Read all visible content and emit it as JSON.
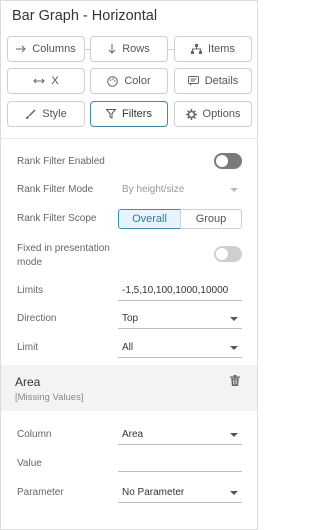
{
  "header": {
    "title": "Bar Graph - Horizontal"
  },
  "toolbar": {
    "columns_label": "Columns",
    "rows_label": "Rows",
    "items_label": "Items",
    "x_label": "X",
    "color_label": "Color",
    "details_label": "Details",
    "style_label": "Style",
    "filters_label": "Filters",
    "options_label": "Options"
  },
  "filters": {
    "rank_filter_enabled": {
      "label": "Rank Filter Enabled",
      "on": false
    },
    "rank_filter_mode": {
      "label": "Rank Filter Mode",
      "value": "By height/size"
    },
    "rank_filter_scope": {
      "label": "Rank Filter Scope",
      "options": [
        "Overall",
        "Group"
      ],
      "selected": "Overall"
    },
    "fixed_presentation": {
      "label_line1": "Fixed in presentation",
      "label_line2": "mode",
      "on": false
    },
    "limits": {
      "label": "Limits",
      "value": "-1,5,10,100,1000,10000"
    },
    "direction": {
      "label": "Direction",
      "value": "Top"
    },
    "limit": {
      "label": "Limit",
      "value": "All"
    }
  },
  "area_section": {
    "title": "Area",
    "subtitle": "[Missing Values]",
    "column": {
      "label": "Column",
      "value": "Area"
    },
    "value": {
      "label": "Value",
      "value": ""
    },
    "parameter": {
      "label": "Parameter",
      "value": "No Parameter"
    }
  },
  "colors": {
    "accent": "#3b8ea5",
    "toggle_off": "#7a7a7a",
    "section_bg": "#f3f3f3"
  }
}
